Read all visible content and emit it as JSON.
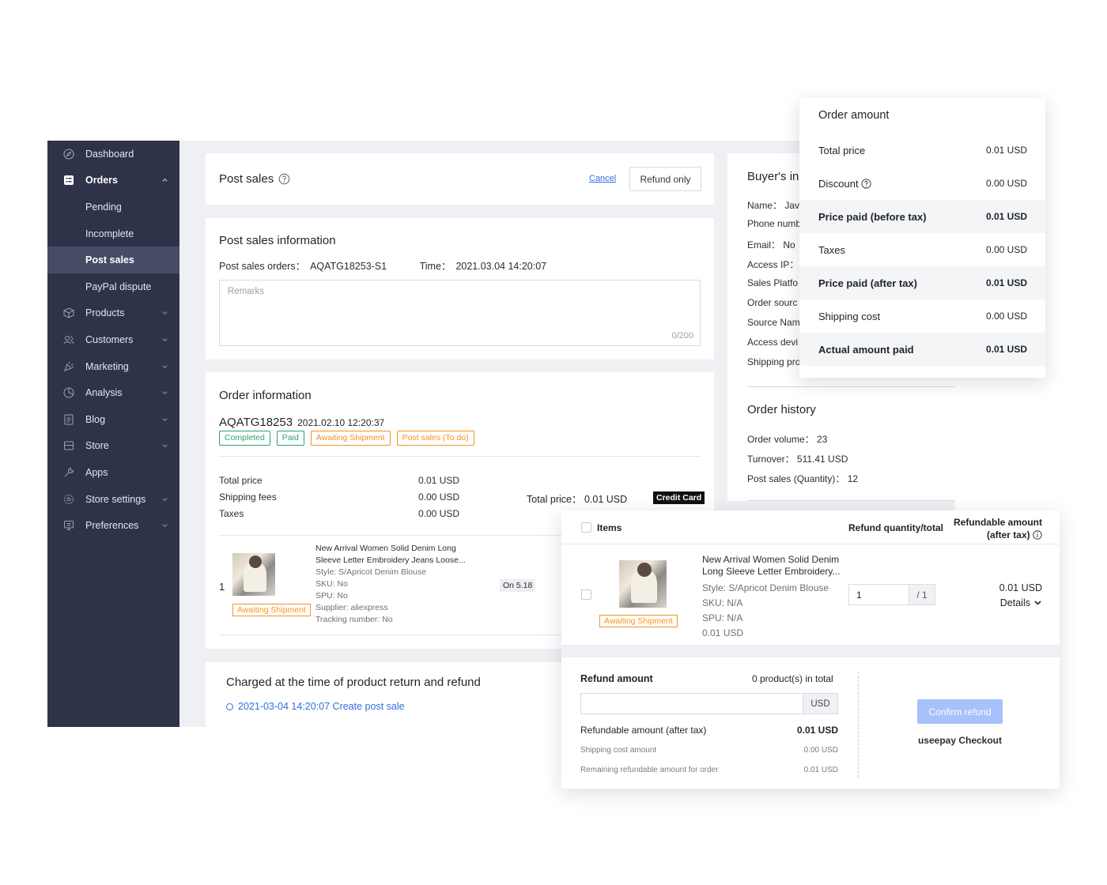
{
  "sidebar": {
    "items": [
      {
        "label": "Dashboard",
        "icon": "compass-icon"
      },
      {
        "label": "Orders",
        "icon": "orders-icon"
      },
      {
        "label": "Pending"
      },
      {
        "label": "Incomplete"
      },
      {
        "label": "Post sales"
      },
      {
        "label": "PayPal dispute"
      },
      {
        "label": "Products",
        "icon": "box-icon"
      },
      {
        "label": "Customers",
        "icon": "customers-icon"
      },
      {
        "label": "Marketing",
        "icon": "megaphone-icon"
      },
      {
        "label": "Analysis",
        "icon": "pie-chart-icon"
      },
      {
        "label": "Blog",
        "icon": "document-icon"
      },
      {
        "label": "Store",
        "icon": "store-icon"
      },
      {
        "label": "Apps",
        "icon": "wrench-icon"
      },
      {
        "label": "Store settings",
        "icon": "gear-icon"
      },
      {
        "label": "Preferences",
        "icon": "monitor-icon"
      }
    ]
  },
  "header": {
    "title": "Post sales",
    "cancel_label": "Cancel",
    "refund_only_label": "Refund only"
  },
  "post_info": {
    "title": "Post sales information",
    "orders_label": "Post sales orders：",
    "orders_value": "AQATG18253-S1",
    "time_label": "Time：",
    "time_value": "2021.03.04 14:20:07",
    "remarks_placeholder": "Remarks",
    "remarks_count": "0/200"
  },
  "order_info": {
    "title": "Order information",
    "order_no": "AQATG18253",
    "order_date": "2021.02.10 12:20:37",
    "badges": [
      "Completed",
      "Paid",
      "Awaiting Shipment",
      "Post sales (To do)"
    ],
    "rows": [
      {
        "label": "Total price",
        "value": "0.01 USD"
      },
      {
        "label": "Shipping fees",
        "value": "0.00 USD"
      },
      {
        "label": "Taxes",
        "value": "0.00 USD"
      }
    ],
    "total_label": "Total price：",
    "total_value": "0.01 USD",
    "payment_method": "Credit Card",
    "product": {
      "index": "1",
      "status": "Awaiting Shipment",
      "name_line1": "New Arrival Women Solid Denim Long",
      "name_line2": "Sleeve Letter Embroidery Jeans Loose...",
      "style": "Style: S/Apricot Denim Blouse",
      "sku": "SKU: No",
      "spu": "SPU: No",
      "supplier": "Supplier: aliexpress",
      "tracking": "Tracking number: No",
      "on_badge": "On 5.18",
      "cut": "0."
    }
  },
  "charged": {
    "title": "Charged at the time of product return and refund",
    "event": "2021-03-04 14:20:07 Create post sale"
  },
  "buyer": {
    "title": "Buyer's in",
    "fields": [
      "Name： Jav",
      "Phone numb",
      "Email： No",
      "Access IP：",
      "Sales Platfo",
      "Order sourc",
      "Source Nam",
      "Access devi",
      "Shipping pro"
    ]
  },
  "history": {
    "title": "Order history",
    "fields": [
      "Order volume： 23",
      "Turnover： 511.41 USD",
      "Post sales (Quantity)： 12"
    ]
  },
  "order_amount": {
    "title": "Order amount",
    "rows": [
      {
        "label": "Total price",
        "value": "0.01 USD"
      },
      {
        "label": "Discount",
        "value": "0.00 USD"
      },
      {
        "label": "Price paid (before tax)",
        "value": "0.01 USD"
      },
      {
        "label": "Taxes",
        "value": "0.00 USD"
      },
      {
        "label": "Price paid (after tax)",
        "value": "0.01 USD"
      },
      {
        "label": "Shipping cost",
        "value": "0.00 USD"
      },
      {
        "label": "Actual amount paid",
        "value": "0.01 USD"
      }
    ]
  },
  "refund": {
    "col_items": "Items",
    "col_qty": "Refund quantity/total",
    "col_amount_line1": "Refundable amount",
    "col_amount_line2": "(after tax)",
    "item": {
      "status": "Awaiting Shipment",
      "name_line1": "New Arrival Women Solid Denim",
      "name_line2": "Long Sleeve Letter Embroidery...",
      "style": "Style: S/Apricot Denim Blouse",
      "sku": "SKU: N/A",
      "spu": "SPU: N/A",
      "price": "0.01 USD",
      "qty_value": "1",
      "qty_total": "/ 1",
      "amount": "0.01 USD",
      "details_label": "Details"
    },
    "amount_label": "Refund amount",
    "products_count": "0 product(s) in total",
    "currency": "USD",
    "refundable_label": "Refundable amount (after tax)",
    "refundable_value": "0.01 USD",
    "shipping_label": "Shipping cost amount",
    "shipping_value": "0.00 USD",
    "remaining_label": "Remaining refundable amount for order",
    "remaining_value": "0.01 USD",
    "confirm_label": "Confirm refund",
    "checkout_label": "useepay Checkout"
  }
}
